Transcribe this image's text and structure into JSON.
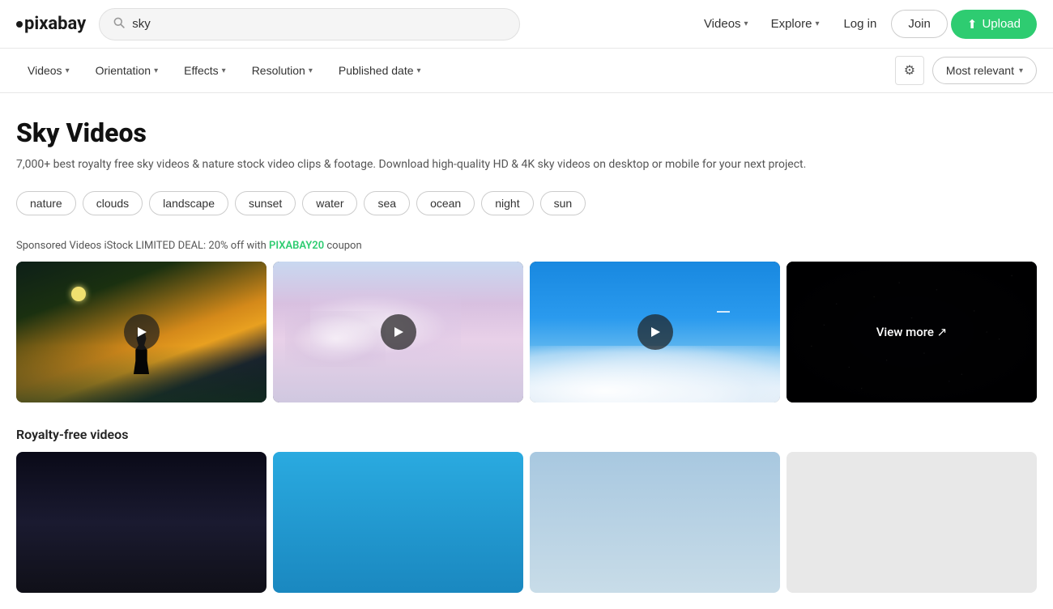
{
  "header": {
    "logo_text": "pixabay",
    "search_value": "sky",
    "search_placeholder": "sky",
    "nav": {
      "videos_label": "Videos",
      "explore_label": "Explore",
      "login_label": "Log in",
      "join_label": "Join",
      "upload_label": "Upload"
    }
  },
  "filter_bar": {
    "filters": [
      {
        "label": "Videos",
        "id": "videos-filter"
      },
      {
        "label": "Orientation",
        "id": "orientation-filter"
      },
      {
        "label": "Effects",
        "id": "effects-filter"
      },
      {
        "label": "Resolution",
        "id": "resolution-filter"
      },
      {
        "label": "Published date",
        "id": "published-date-filter"
      }
    ],
    "sort_label": "Most relevant"
  },
  "main": {
    "page_title": "Sky Videos",
    "page_desc": "7,000+ best royalty free sky videos & nature stock video clips & footage. Download high-quality HD & 4K sky videos on desktop or mobile for your next project.",
    "tags": [
      "nature",
      "clouds",
      "landscape",
      "sunset",
      "water",
      "sea",
      "ocean",
      "night",
      "sun"
    ]
  },
  "sponsored": {
    "label_before": "Sponsored Videos iStock LIMITED DEAL: 20% off with ",
    "coupon_code": "PIXABAY20",
    "label_after": " coupon"
  },
  "video_grid": [
    {
      "id": "vid-1",
      "type": "dark-landscape"
    },
    {
      "id": "vid-2",
      "type": "pink-clouds"
    },
    {
      "id": "vid-3",
      "type": "blue-sky-clouds"
    },
    {
      "id": "vid-4",
      "type": "stars",
      "view_more": true,
      "view_more_label": "View more"
    }
  ],
  "royalty_free": {
    "label": "Royalty-free videos"
  },
  "icons": {
    "search": "🔍",
    "chevron": "▾",
    "upload_arrow": "⬆",
    "settings_gear": "⚙",
    "play": "▶",
    "external_link": "↗"
  }
}
